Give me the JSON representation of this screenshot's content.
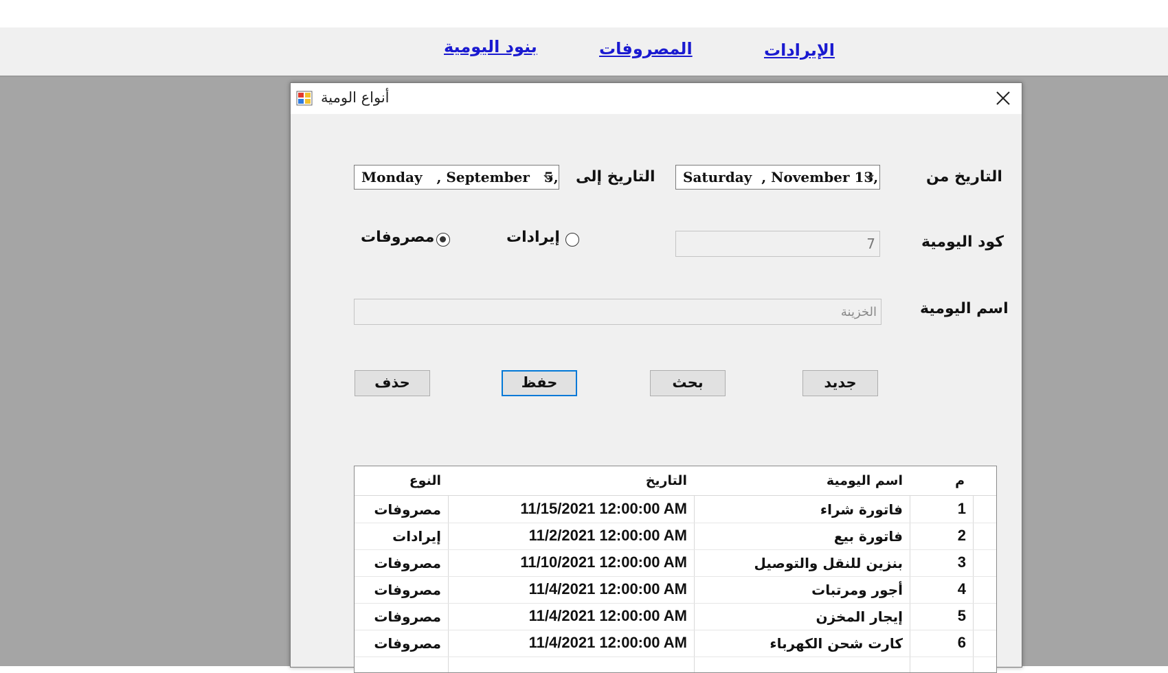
{
  "menu": {
    "items": [
      {
        "label": "بنود اليومية"
      },
      {
        "label": "المصروفات"
      },
      {
        "label": "الإيرادات"
      }
    ]
  },
  "dialog": {
    "title": "أنواع الومية",
    "icon": "app-window-icon",
    "date_from_label": "التاريخ من",
    "date_from_value": "Saturday  , November 13,",
    "date_to_label": "التاريخ إلى",
    "date_to_value": "Monday   , September   5,",
    "code_label": "كود اليومية",
    "code_value": "7",
    "name_label": "اسم اليومية",
    "name_value": "الخزينة",
    "radio_revenue": "إيرادات",
    "radio_expenses": "مصروفات",
    "selected_type": "مصروفات",
    "buttons": {
      "new": "جديد",
      "search": "بحث",
      "save": "حفظ",
      "delete": "حذف"
    }
  },
  "grid": {
    "headers": {
      "num": "م",
      "name": "اسم اليومية",
      "date": "التاريخ",
      "type": "النوع"
    },
    "rows": [
      {
        "num": "1",
        "name": "فاتورة شراء",
        "date": "11/15/2021 12:00:00 AM",
        "type": "مصروفات"
      },
      {
        "num": "2",
        "name": "فاتورة بيع",
        "date": "11/2/2021 12:00:00 AM",
        "type": "إيرادات"
      },
      {
        "num": "3",
        "name": "بنزين للنقل والتوصيل",
        "date": "11/10/2021 12:00:00 AM",
        "type": "مصروفات"
      },
      {
        "num": "4",
        "name": "أجور ومرتبات",
        "date": "11/4/2021 12:00:00 AM",
        "type": "مصروفات"
      },
      {
        "num": "5",
        "name": "إيجار المخزن",
        "date": "11/4/2021 12:00:00 AM",
        "type": "مصروفات"
      },
      {
        "num": "6",
        "name": "كارت شحن الكهرباء",
        "date": "11/4/2021 12:00:00 AM",
        "type": "مصروفات"
      }
    ]
  }
}
